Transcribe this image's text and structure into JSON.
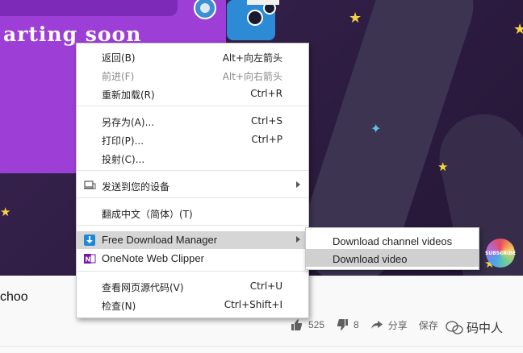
{
  "video": {
    "banner_text": "arting soon",
    "subscribe_badge": "SUBSCRIBE"
  },
  "below": {
    "title_fragment": "choo",
    "likes": "525",
    "dislikes": "8",
    "share_label": "分享",
    "save_label": "保存",
    "watermark": "码中人"
  },
  "context_menu": {
    "items": [
      {
        "label": "返回(B)",
        "shortcut": "Alt+向左箭头",
        "enabled": true
      },
      {
        "label": "前进(F)",
        "shortcut": "Alt+向右箭头",
        "enabled": false
      },
      {
        "label": "重新加载(R)",
        "shortcut": "Ctrl+R",
        "enabled": true
      },
      {
        "label": "另存为(A)...",
        "shortcut": "Ctrl+S",
        "enabled": true
      },
      {
        "label": "打印(P)...",
        "shortcut": "Ctrl+P",
        "enabled": true
      },
      {
        "label": "投射(C)...",
        "shortcut": "",
        "enabled": true
      },
      {
        "label": "发送到您的设备",
        "shortcut": "",
        "enabled": true,
        "icon": "devices-icon",
        "submenu": true
      },
      {
        "label": "翻成中文（简体）(T)",
        "shortcut": "",
        "enabled": true
      },
      {
        "label": "Free Download Manager",
        "shortcut": "",
        "enabled": true,
        "icon": "fdm-icon",
        "submenu": true,
        "highlighted": true
      },
      {
        "label": "OneNote Web Clipper",
        "shortcut": "",
        "enabled": true,
        "icon": "onenote-icon"
      },
      {
        "label": "查看网页源代码(V)",
        "shortcut": "Ctrl+U",
        "enabled": true
      },
      {
        "label": "检查(N)",
        "shortcut": "Ctrl+Shift+I",
        "enabled": true
      }
    ]
  },
  "submenu": {
    "items": [
      {
        "label": "Download channel videos",
        "highlighted": false
      },
      {
        "label": "Download video",
        "highlighted": true
      }
    ]
  },
  "colors": {
    "menu_highlight": "#d6d6d6",
    "banner_purple": "#9d3fd6",
    "star_yellow": "#f4d343"
  }
}
